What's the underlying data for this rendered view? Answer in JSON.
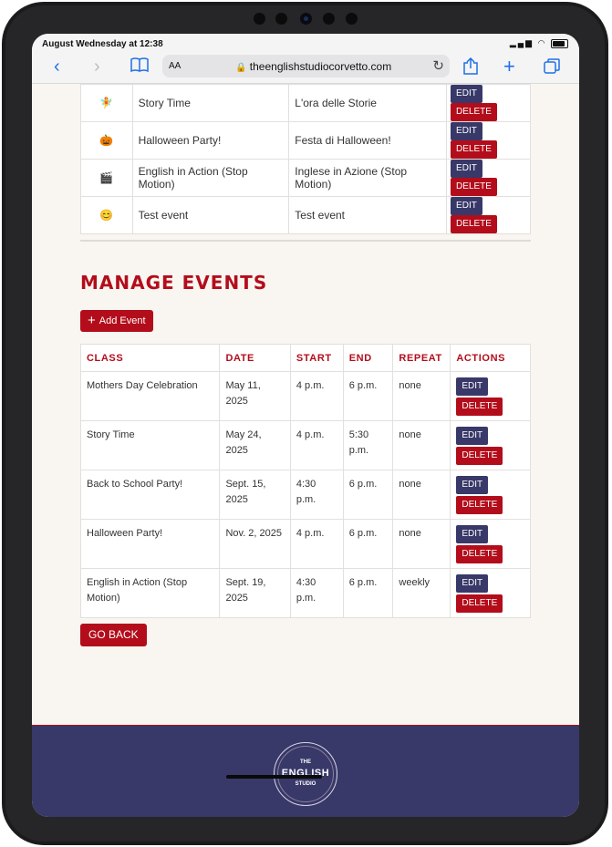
{
  "status_bar": {
    "time": "August Wednesday at 12:38"
  },
  "browser": {
    "aa_label": "AA",
    "url": "theenglishstudiocorvetto.com",
    "icons": [
      "back-icon",
      "forward-icon",
      "bookmarks-icon",
      "lock-icon",
      "reload-icon",
      "share-icon",
      "new-tab-icon",
      "tabs-icon"
    ]
  },
  "translations": {
    "rows": [
      {
        "emoji": "🧚",
        "english": "Story Time",
        "italian": "L'ora delle Storie"
      },
      {
        "emoji": "🎃",
        "english": "Halloween Party!",
        "italian": "Festa di Halloween!"
      },
      {
        "emoji": "🎬",
        "english": "English in Action (Stop Motion)",
        "italian": "Inglese in Azione (Stop Motion)"
      },
      {
        "emoji": "😊",
        "english": "Test event",
        "italian": "Test event"
      }
    ],
    "edit_label": "EDIT",
    "delete_label": "DELETE"
  },
  "manage_events": {
    "title": "MANAGE EVENTS",
    "add_label": "Add Event",
    "columns": [
      "CLASS",
      "DATE",
      "START",
      "END",
      "REPEAT",
      "ACTIONS"
    ],
    "rows": [
      {
        "class": "Mothers Day Celebration",
        "date": "May 11, 2025",
        "start": "4 p.m.",
        "end": "6 p.m.",
        "repeat": "none"
      },
      {
        "class": "Story Time",
        "date": "May 24, 2025",
        "start": "4 p.m.",
        "end": "5:30 p.m.",
        "repeat": "none"
      },
      {
        "class": "Back to School Party!",
        "date": "Sept. 15, 2025",
        "start": "4:30 p.m.",
        "end": "6 p.m.",
        "repeat": "none"
      },
      {
        "class": "Halloween Party!",
        "date": "Nov. 2, 2025",
        "start": "4 p.m.",
        "end": "6 p.m.",
        "repeat": "none"
      },
      {
        "class": "English in Action (Stop Motion)",
        "date": "Sept. 19, 2025",
        "start": "4:30 p.m.",
        "end": "6 p.m.",
        "repeat": "weekly"
      }
    ],
    "edit_label": "EDIT",
    "delete_label": "DELETE",
    "go_back_label": "GO BACK"
  },
  "footer": {
    "logo_top": "THE",
    "logo_main": "ENGLISH",
    "logo_bottom": "STUDIO"
  },
  "colors": {
    "brand_red": "#b30d1b",
    "brand_navy": "#383869",
    "page_bg": "#f9f6f1"
  }
}
